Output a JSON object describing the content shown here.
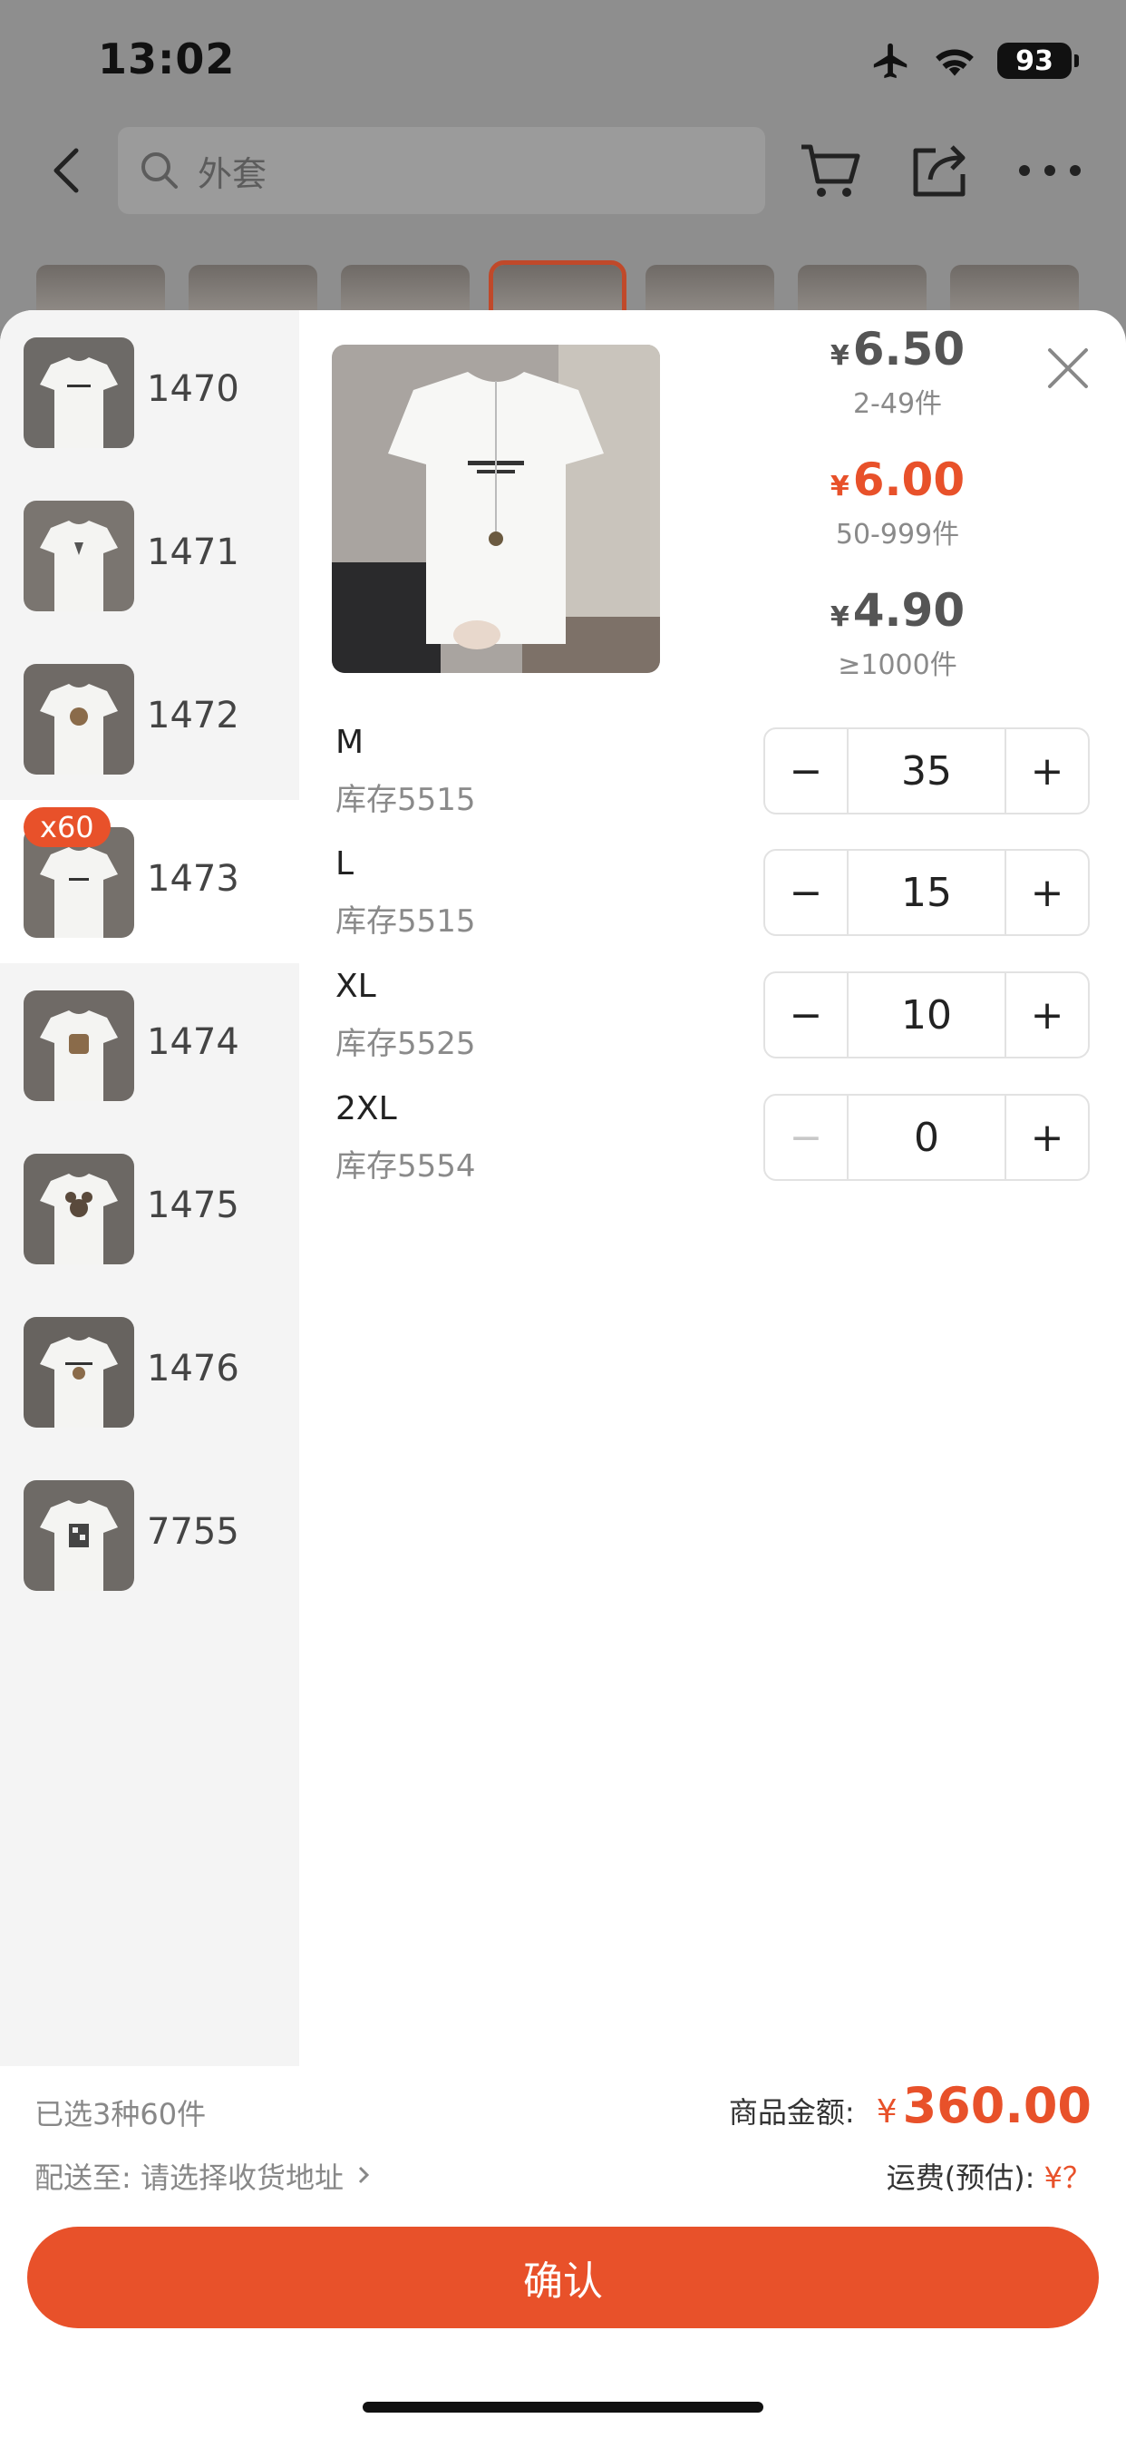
{
  "status_bar": {
    "time": "13:02",
    "battery": "93"
  },
  "topbar": {
    "search_placeholder": "外套"
  },
  "sidebar": {
    "items": [
      {
        "label": "1470",
        "badge": ""
      },
      {
        "label": "1471",
        "badge": ""
      },
      {
        "label": "1472",
        "badge": ""
      },
      {
        "label": "1473",
        "badge": "x60",
        "active": true
      },
      {
        "label": "1474",
        "badge": ""
      },
      {
        "label": "1475",
        "badge": ""
      },
      {
        "label": "1476",
        "badge": ""
      },
      {
        "label": "7755",
        "badge": ""
      }
    ]
  },
  "price_tiers": [
    {
      "currency": "¥",
      "price": "6.50",
      "range": "2-49件"
    },
    {
      "currency": "¥",
      "price": "6.00",
      "range": "50-999件",
      "highlight": true
    },
    {
      "currency": "¥",
      "price": "4.90",
      "range": "≥1000件"
    }
  ],
  "skus": [
    {
      "name": "M",
      "stock": "库存5515",
      "qty": "35"
    },
    {
      "name": "L",
      "stock": "库存5515",
      "qty": "15"
    },
    {
      "name": "XL",
      "stock": "库存5525",
      "qty": "10"
    },
    {
      "name": "2XL",
      "stock": "库存5554",
      "qty": "0"
    }
  ],
  "stepper": {
    "minus": "−",
    "plus": "+"
  },
  "footer": {
    "selected": "已选3种60件",
    "ship_label": "配送至:",
    "ship_address": "请选择收货地址",
    "amount_label": "商品金额:",
    "amount_currency": "¥",
    "amount_value": "360.00",
    "freight_label": "运费(预估):",
    "freight_value": "¥？",
    "confirm": "确认"
  },
  "colors": {
    "accent": "#e8512a",
    "sidebar_bg": "#f4f4f4"
  }
}
